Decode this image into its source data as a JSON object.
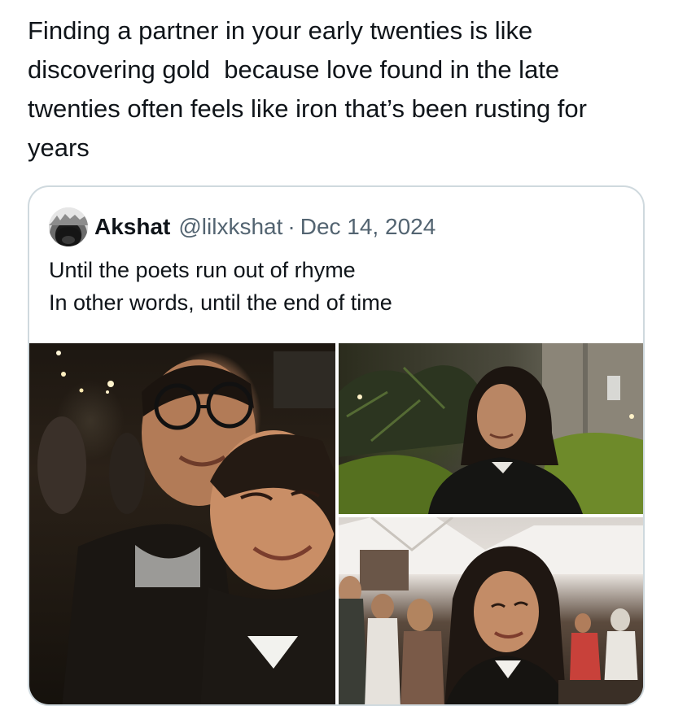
{
  "tweet": {
    "text": "Finding a partner in your early twenties is like discovering gold  because love found in the late twenties often feels like iron that’s been rusting for years"
  },
  "quoted_tweet": {
    "author_name": "Akshat",
    "author_handle": "@lilxkshat",
    "separator": "·",
    "date": "Dec 14, 2024",
    "lines": [
      "Until the poets run out of rhyme",
      "In other words, until the end of time"
    ]
  },
  "media": {
    "photos": [
      {
        "name": "photo-selfie-couple"
      },
      {
        "name": "photo-woman-garden-night"
      },
      {
        "name": "photo-woman-smiling-tents"
      }
    ]
  }
}
